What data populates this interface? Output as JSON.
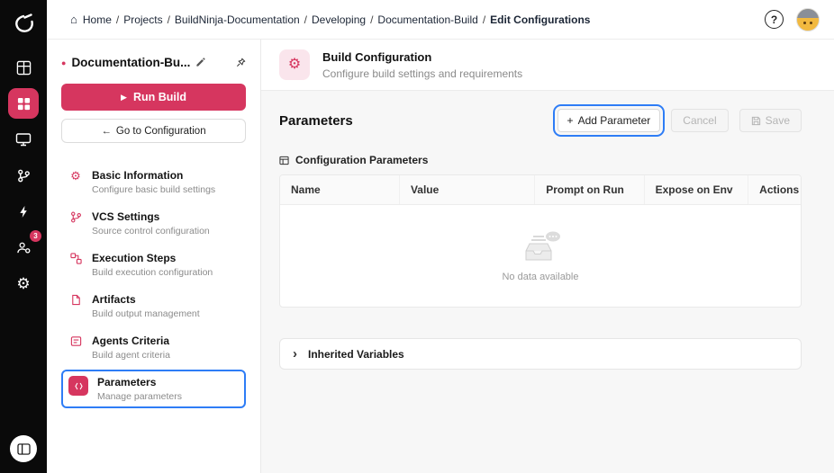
{
  "icons": {
    "home": "⌂",
    "help": "?",
    "play": "▶",
    "back_arrow": "←",
    "gear": "⚙",
    "plus": "+",
    "chevron_right": "›",
    "status_dot": "●",
    "separator": "/"
  },
  "breadcrumb": [
    "Home",
    "Projects",
    "BuildNinja-Documentation",
    "Developing",
    "Documentation-Build",
    "Edit Configurations"
  ],
  "rail": {
    "notification_count": "3"
  },
  "sidebar": {
    "project_title": "Documentation-Bu...",
    "run_button": "Run Build",
    "goto_config_button": "Go to Configuration",
    "items": [
      {
        "label": "Basic Information",
        "description": "Configure basic build settings"
      },
      {
        "label": "VCS Settings",
        "description": "Source control configuration"
      },
      {
        "label": "Execution Steps",
        "description": "Build execution configuration"
      },
      {
        "label": "Artifacts",
        "description": "Build output management"
      },
      {
        "label": "Agents Criteria",
        "description": "Build agent criteria"
      },
      {
        "label": "Parameters",
        "description": "Manage parameters"
      }
    ]
  },
  "page_header": {
    "title": "Build Configuration",
    "subtitle": "Configure build settings and requirements"
  },
  "parameters": {
    "title": "Parameters",
    "add_button": "Add Parameter",
    "cancel_button": "Cancel",
    "save_button": "Save",
    "list_caption": "Configuration Parameters",
    "table_headers": [
      "Name",
      "Value",
      "Prompt on Run",
      "Expose on Env",
      "Actions"
    ],
    "empty_text": "No data available",
    "inherited_section": "Inherited Variables"
  }
}
